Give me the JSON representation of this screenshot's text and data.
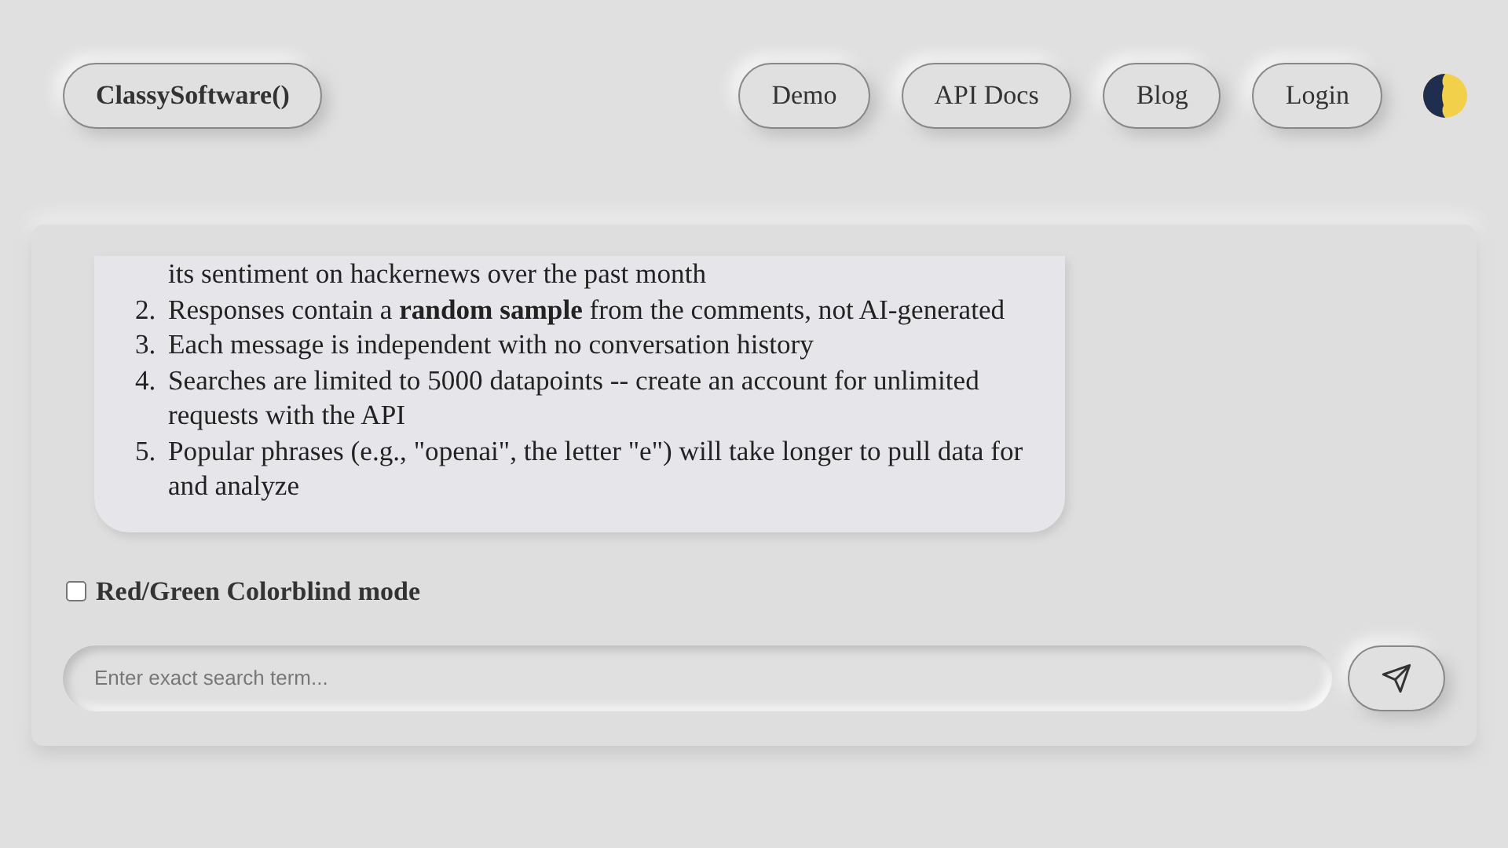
{
  "header": {
    "brand": "ClassySoftware()",
    "nav": [
      {
        "label": "Demo"
      },
      {
        "label": "API Docs"
      },
      {
        "label": "Blog"
      },
      {
        "label": "Login"
      }
    ]
  },
  "message": {
    "items": [
      {
        "text": "its sentiment on hackernews over the past month"
      },
      {
        "number": "2.",
        "text": "Responses contain a **random sample** from the comments, not AI-generated"
      },
      {
        "number": "3.",
        "text": "Each message is independent with no conversation history"
      },
      {
        "number": "4.",
        "text": "Searches are limited to 5000 datapoints -- create an account for unlimited requests with the API"
      },
      {
        "number": "5.",
        "text": "Popular phrases (e.g., \"openai\", the letter \"e\") will take longer to pull data for and analyze"
      }
    ]
  },
  "colorblind": {
    "label": "Red/Green Colorblind mode",
    "checked": false
  },
  "search": {
    "placeholder": "Enter exact search term..."
  }
}
